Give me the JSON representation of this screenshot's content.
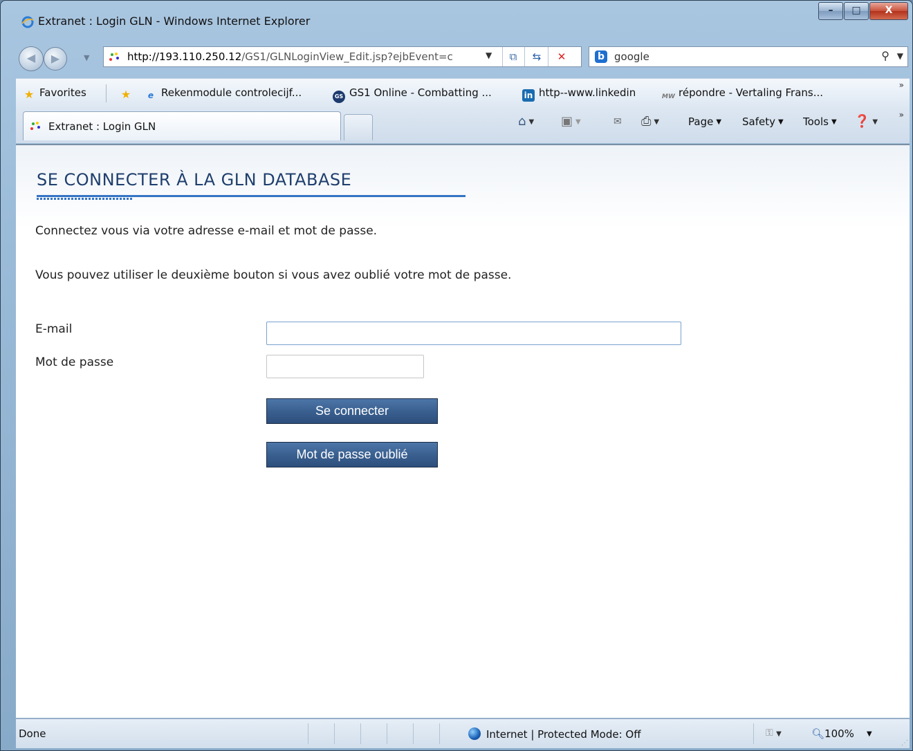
{
  "window": {
    "title": "Extranet : Login GLN - Windows Internet Explorer",
    "minimize": "–",
    "maximize": "□",
    "close": "X"
  },
  "navbar": {
    "address_host": "http://193.110.250.12",
    "address_path": "/GS1/GLNLoginView_Edit.jsp?ejbEvent=c",
    "search_value": "google"
  },
  "favorites": {
    "label": "Favorites",
    "items": [
      {
        "label": "Rekenmodule controlecijf...",
        "icon": "ie-icon"
      },
      {
        "label": "GS1 Online - Combatting ...",
        "icon": "gs1-icon"
      },
      {
        "label": "http--www.linkedin",
        "icon": "linkedin-icon"
      },
      {
        "label": "répondre - Vertaling Frans...",
        "icon": "mw-icon"
      }
    ]
  },
  "tabs": {
    "active_label": "Extranet : Login GLN"
  },
  "commands": {
    "page": "Page",
    "safety": "Safety",
    "tools": "Tools"
  },
  "page": {
    "title": "SE CONNECTER À LA GLN DATABASE",
    "intro1": "Connectez vous via votre adresse e-mail et mot de passe.",
    "intro2": "Vous pouvez utiliser le deuxième bouton si vous avez oublié votre mot de passe.",
    "email_label": "E-mail",
    "email_value": "",
    "password_label": "Mot de passe",
    "password_value": "",
    "login_button": "Se connecter",
    "forgot_button": "Mot de passe oublié"
  },
  "status": {
    "text": "Done",
    "zone": "Internet | Protected Mode: Off",
    "zoom": "100%"
  },
  "colors": {
    "heading": "#1f3f6e",
    "accent": "#3474c4",
    "button": "#3a6090"
  }
}
